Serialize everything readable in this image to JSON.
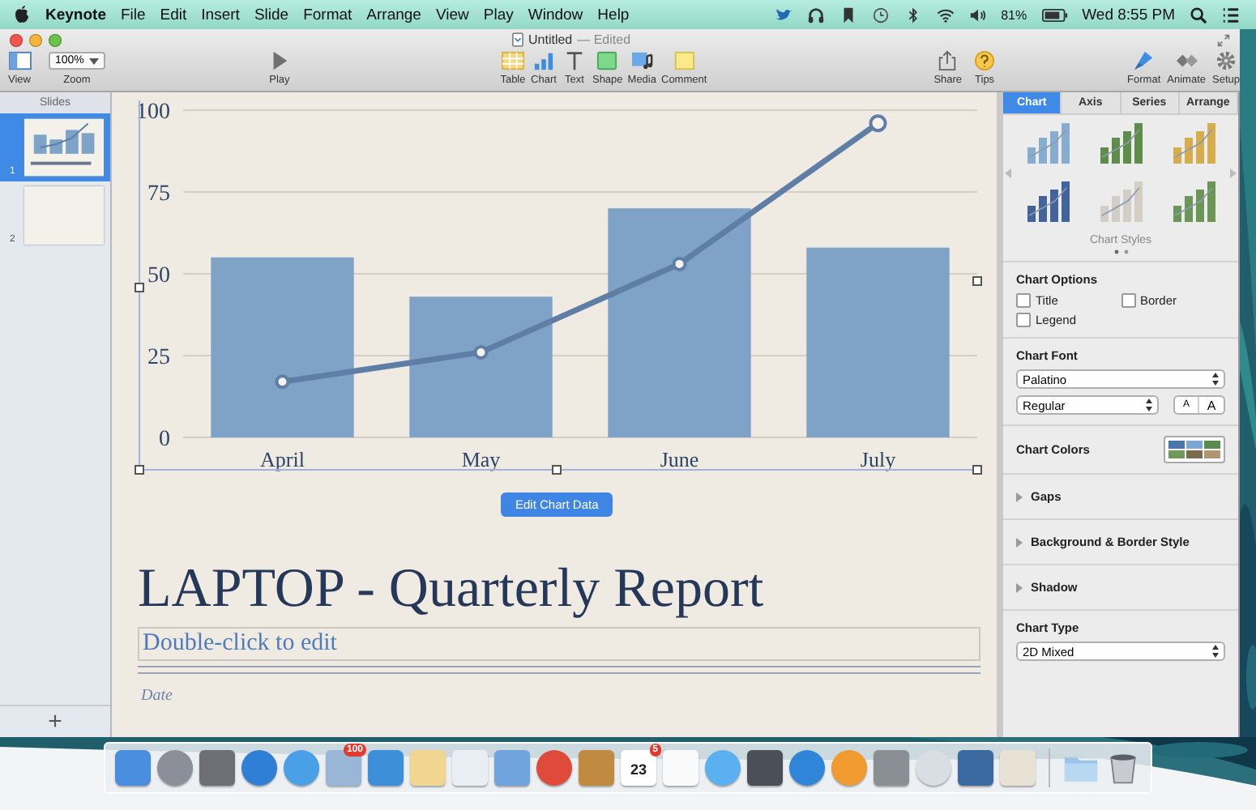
{
  "menu_bar": {
    "app": "Keynote",
    "items": [
      "File",
      "Edit",
      "Insert",
      "Slide",
      "Format",
      "Arrange",
      "View",
      "Play",
      "Window",
      "Help"
    ],
    "battery": "81%",
    "clock": "Wed 8:55 PM"
  },
  "window": {
    "title": "Untitled",
    "status": "— Edited"
  },
  "toolbar": [
    {
      "kind": "view",
      "label": "View"
    },
    {
      "kind": "zoom",
      "label": "Zoom",
      "value": "100%"
    },
    {
      "kind": "play",
      "label": "Play"
    },
    {
      "kind": "table",
      "label": "Table"
    },
    {
      "kind": "chart",
      "label": "Chart"
    },
    {
      "kind": "text",
      "label": "Text"
    },
    {
      "kind": "shape",
      "label": "Shape"
    },
    {
      "kind": "media",
      "label": "Media"
    },
    {
      "kind": "comment",
      "label": "Comment"
    },
    {
      "kind": "share",
      "label": "Share"
    },
    {
      "kind": "tips",
      "label": "Tips"
    },
    {
      "kind": "format",
      "label": "Format"
    },
    {
      "kind": "animate",
      "label": "Animate"
    },
    {
      "kind": "setup",
      "label": "Setup"
    }
  ],
  "slides": {
    "heading": "Slides",
    "items": [
      {
        "number": "1",
        "selected": true
      },
      {
        "number": "2",
        "selected": false
      }
    ],
    "add": "+"
  },
  "slide": {
    "chart_data": {
      "type": "bar",
      "categories": [
        "April",
        "May",
        "June",
        "July"
      ],
      "ylim": [
        0,
        100
      ],
      "yticks": [
        0,
        25,
        50,
        75,
        100
      ],
      "grid": true,
      "series": [
        {
          "type": "bar",
          "color": "#7ea3c6",
          "values": [
            55,
            43,
            70,
            58
          ]
        },
        {
          "type": "line",
          "color": "#5e7ea6",
          "marker": "circle",
          "values": [
            17,
            26,
            53,
            96
          ]
        }
      ]
    },
    "edit_button": "Edit Chart Data",
    "title": "LAPTOP - Quarterly Report",
    "subtitle": {
      "placeholder": "Double-click to edit"
    },
    "date": "Date"
  },
  "inspector": {
    "tabs": [
      {
        "label": "Chart",
        "selected": true
      },
      {
        "label": "Axis",
        "selected": false
      },
      {
        "label": "Series",
        "selected": false
      },
      {
        "label": "Arrange",
        "selected": false
      }
    ],
    "chart_styles": {
      "label": "Chart Styles",
      "styles": [
        {
          "color": "#86add0"
        },
        {
          "color": "#5e8c4a"
        },
        {
          "color": "#d6ad4c"
        },
        {
          "color": "#44639a"
        },
        {
          "color": "#d2cec6"
        },
        {
          "color": "#6c9558"
        }
      ]
    },
    "chart_options": {
      "heading": "Chart Options",
      "options": [
        {
          "label": "Title",
          "checked": false
        },
        {
          "label": "Border",
          "checked": false
        },
        {
          "label": "Legend",
          "checked": false
        }
      ]
    },
    "chart_font": {
      "heading": "Chart Font",
      "family": "Palatino",
      "style": "Regular",
      "smaller": "A",
      "larger": "A"
    },
    "chart_colors": {
      "heading": "Chart Colors",
      "swatches": [
        {
          "color": "#4a77a8"
        },
        {
          "color": "#7ba7d0"
        },
        {
          "color": "#5c8a4e"
        },
        {
          "color": "#6f9a5a"
        },
        {
          "color": "#7a6a50"
        },
        {
          "color": "#b09570"
        }
      ]
    },
    "sections": [
      {
        "label": "Gaps",
        "expanded": false
      },
      {
        "label": "Background & Border Style",
        "expanded": false
      },
      {
        "label": "Shadow",
        "expanded": false
      }
    ],
    "chart_type": {
      "heading": "Chart Type",
      "value": "2D Mixed"
    }
  },
  "dock": {
    "mail_badge": "100",
    "calendar_day": "23",
    "calendar_badge": "5"
  }
}
